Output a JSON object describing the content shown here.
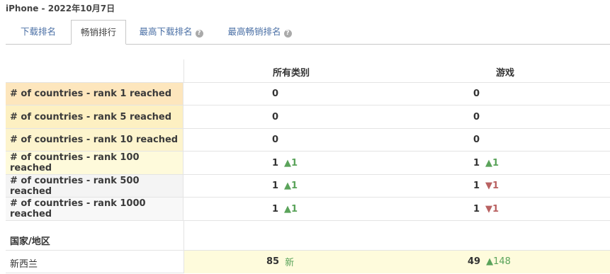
{
  "header": {
    "title": "iPhone - 2022年10月7日"
  },
  "tabs": [
    {
      "label": "下载排名",
      "help": false
    },
    {
      "label": "畅销排行",
      "help": false,
      "active": true
    },
    {
      "label": "最高下载排名",
      "help": true
    },
    {
      "label": "最高畅销排名",
      "help": true
    }
  ],
  "icons": {
    "help": "help-circle-icon",
    "up": "arrow-up-icon",
    "down": "arrow-down-icon"
  },
  "columns": [
    "所有类别",
    "游戏"
  ],
  "rows": [
    {
      "label": "# of countries - rank 1 reached",
      "bg": "#fde6bd",
      "cells": [
        {
          "value": "0"
        },
        {
          "value": "0"
        }
      ]
    },
    {
      "label": "# of countries - rank 5 reached",
      "bg": "#fdf0c2",
      "cells": [
        {
          "value": "0"
        },
        {
          "value": "0"
        }
      ]
    },
    {
      "label": "# of countries - rank 10 reached",
      "bg": "#fdf4cd",
      "cells": [
        {
          "value": "0"
        },
        {
          "value": "0"
        }
      ]
    },
    {
      "label": "# of countries - rank 100 reached",
      "bg": "#fefadb",
      "cells": [
        {
          "value": "1",
          "change": "▲1",
          "dir": "up"
        },
        {
          "value": "1",
          "change": "▲1",
          "dir": "up"
        }
      ]
    },
    {
      "label": "# of countries - rank 500 reached",
      "bg": "#f4f4f4",
      "cells": [
        {
          "value": "1",
          "change": "▲1",
          "dir": "up"
        },
        {
          "value": "1",
          "change": "▼1",
          "dir": "down"
        }
      ]
    },
    {
      "label": "# of countries - rank 1000 reached",
      "bg": "#f8f8f8",
      "cells": [
        {
          "value": "1",
          "change": "▲1",
          "dir": "up"
        },
        {
          "value": "1",
          "change": "▼1",
          "dir": "down"
        }
      ]
    }
  ],
  "section": {
    "title": "国家/地区"
  },
  "countries": [
    {
      "name": "新西兰",
      "bg": "#fefbdc",
      "cells": [
        {
          "value": "85",
          "change": "新",
          "dir": "up"
        },
        {
          "value": "49",
          "change": "▲148",
          "dir": "up"
        }
      ]
    }
  ],
  "colors": {
    "link": "#4a6fa5",
    "up": "#5aa35a",
    "down": "#b96262"
  }
}
